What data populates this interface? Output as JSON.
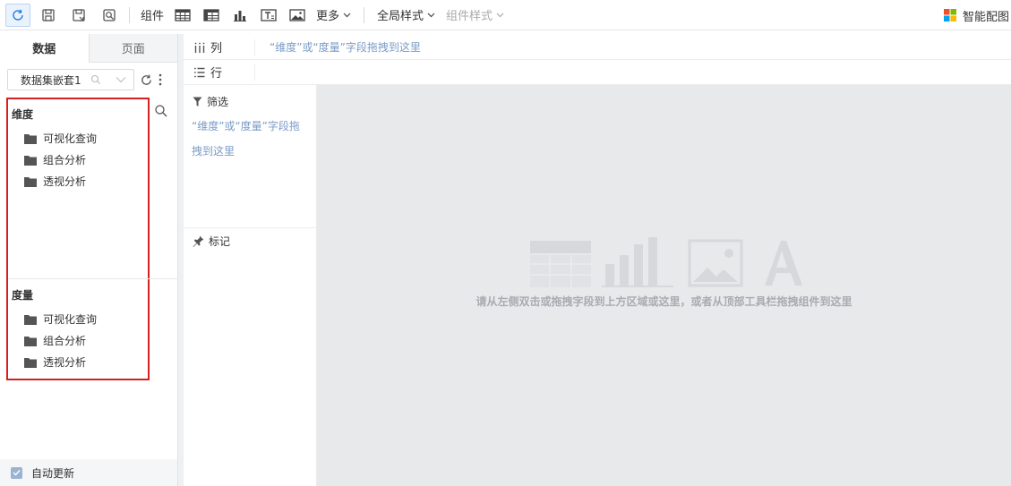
{
  "toolbar": {
    "component_label": "组件",
    "more_label": "更多",
    "global_style_label": "全局样式",
    "component_style_label": "组件样式",
    "smart_chart_label": "智能配图"
  },
  "left_panel": {
    "tabs": [
      {
        "label": "数据",
        "active": true
      },
      {
        "label": "页面",
        "active": false
      }
    ],
    "dataset": {
      "value": "数据集嵌套1"
    },
    "dimension": {
      "title": "维度",
      "items": [
        "可视化查询",
        "组合分析",
        "透视分析"
      ]
    },
    "measure": {
      "title": "度量",
      "items": [
        "可视化查询",
        "组合分析",
        "透视分析"
      ]
    },
    "auto_update": {
      "label": "自动更新",
      "checked": true
    }
  },
  "shelves": {
    "columns": {
      "label": "列",
      "hint": "“维度”或“度量”字段拖拽到这里"
    },
    "rows": {
      "label": "行"
    },
    "filter": {
      "label": "筛选",
      "hint": "“维度”或“度量”字段拖拽到这里"
    },
    "marks": {
      "label": "标记"
    }
  },
  "canvas": {
    "placeholder_text": "请从左侧双击或拖拽字段到上方区域或这里，或者从顶部工具栏拖拽组件到这里"
  },
  "colors": {
    "accent_blue": "#1f7de0",
    "hint_blue": "#7a9cc6",
    "highlight_red": "#d42020",
    "canvas_bg": "#e8e9eb"
  }
}
